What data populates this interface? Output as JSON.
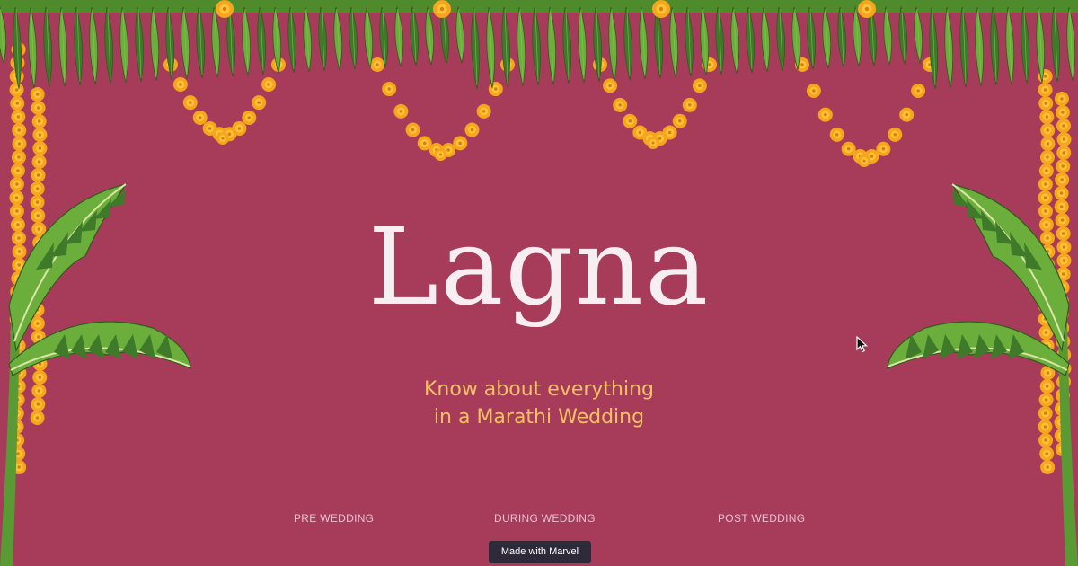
{
  "brand": {
    "title": "Lagna"
  },
  "hero": {
    "tagline_line1": "Know about everything",
    "tagline_line2": "in a Marathi Wedding"
  },
  "nav": {
    "items": [
      {
        "label": "PRE WEDDING"
      },
      {
        "label": "DURING WEDDING"
      },
      {
        "label": "POST WEDDING"
      }
    ]
  },
  "badge": {
    "label": "Made with Marvel"
  },
  "colors": {
    "background": "#a63c5a",
    "title": "#f6eef0",
    "tagline": "#f6c163",
    "nav_text": "#eac0cb",
    "leaf_dark": "#3f7a2a",
    "leaf_light": "#6cae3c",
    "marigold": "#f6a51c",
    "marigold_center": "#e07b0a",
    "badge_bg": "#2f2a3a"
  },
  "icons": [
    "mango-leaf-toran-icon",
    "marigold-garland-icon",
    "banana-leaf-icon",
    "mouse-pointer-icon"
  ]
}
